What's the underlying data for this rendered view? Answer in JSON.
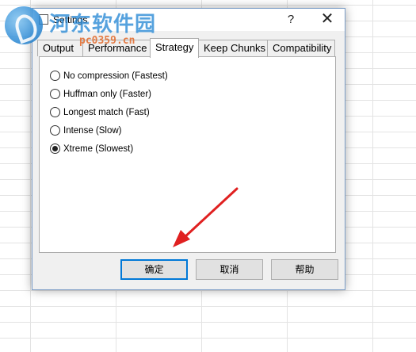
{
  "watermark": {
    "title": "河东软件园",
    "url": "pc0359.cn"
  },
  "dialog": {
    "title": "Settings",
    "help_glyph": "?",
    "close_glyph": "✕"
  },
  "tabs": [
    {
      "label": "Output",
      "active": false
    },
    {
      "label": "Performance",
      "active": false
    },
    {
      "label": "Strategy",
      "active": true
    },
    {
      "label": "Keep Chunks",
      "active": false
    },
    {
      "label": "Compatibility",
      "active": false
    }
  ],
  "strategy_options": [
    {
      "label": "No compression (Fastest)",
      "checked": false
    },
    {
      "label": "Huffman only (Faster)",
      "checked": false
    },
    {
      "label": "Longest match (Fast)",
      "checked": false
    },
    {
      "label": "Intense (Slow)",
      "checked": false
    },
    {
      "label": "Xtreme (Slowest)",
      "checked": true
    }
  ],
  "buttons": {
    "ok": "确定",
    "cancel": "取消",
    "help": "帮助"
  },
  "colors": {
    "annotation_arrow": "#e02020",
    "default_button_border": "#0078d7"
  }
}
